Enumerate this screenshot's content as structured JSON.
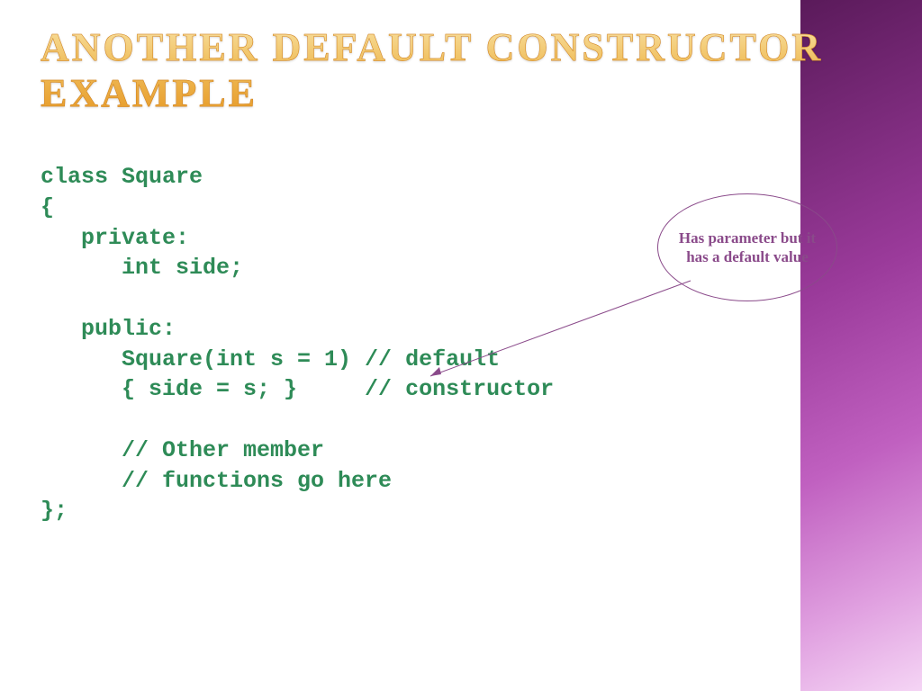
{
  "title": "ANOTHER DEFAULT CONSTRUCTOR EXAMPLE",
  "code": "class Square\n{\n   private:\n      int side;\n\n   public:\n      Square(int s = 1) // default\n      { side = s; }     // constructor\n\n      // Other member\n      // functions go here\n};",
  "callout": {
    "text": "Has parameter but it has a default value"
  }
}
